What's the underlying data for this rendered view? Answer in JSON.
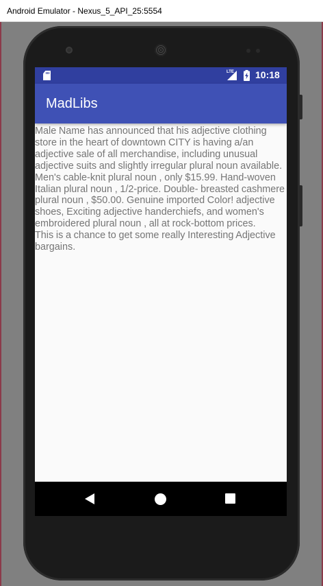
{
  "window": {
    "title": "Android Emulator - Nexus_5_API_25:5554"
  },
  "statusbar": {
    "time": "10:18",
    "network": "LTE",
    "icons": [
      "sd-card-icon",
      "signal-icon",
      "battery-charging-icon"
    ]
  },
  "appbar": {
    "title": "MadLibs"
  },
  "story": {
    "text": " Male Name has announced that his adjective clothing\nstore in the heart of downtown CITY is having a/an\nadjective sale of all merchandise, including unusual\nadjective suits and slightly irregular plural noun available.\nMen's cable-knit plural noun , only $15.99. Hand-woven\nItalian plural noun , 1/2-price. Double- breasted cashmere\nplural noun , $50.00. Genuine imported Color! adjective\nshoes, Exciting adjective handerchiefs, and women's\nembroidered plural noun , all at rock-bottom prices.\nThis is a chance to get some really Interesting Adjective\nbargains."
  },
  "navbar": {
    "buttons": [
      "back-icon",
      "home-icon",
      "recent-apps-icon"
    ]
  },
  "colors": {
    "statusbar": "#303f9f",
    "appbar": "#3f51b5",
    "screen_bg": "#fafafa",
    "story_text": "#757575"
  }
}
